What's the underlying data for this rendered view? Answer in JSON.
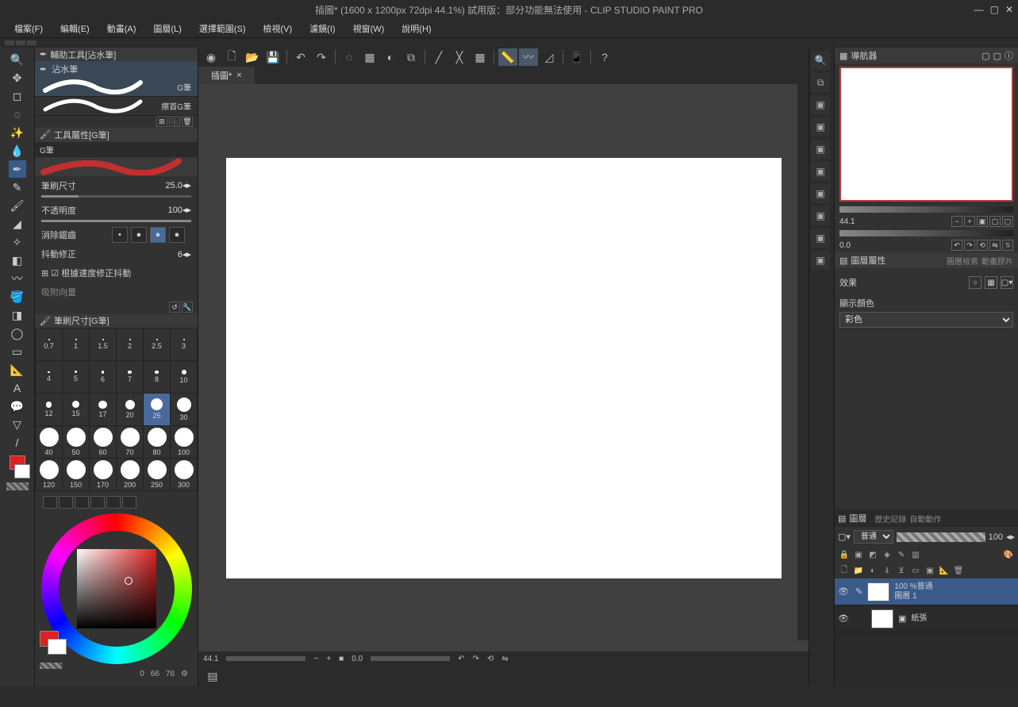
{
  "title": "插圖* (1600 x 1200px 72dpi 44.1%)  試用版：部分功能無法使用 - CLIP STUDIO PAINT PRO",
  "menu": [
    "檔案(F)",
    "編輯(E)",
    "動畫(A)",
    "圖層(L)",
    "選擇範圍(S)",
    "檢視(V)",
    "濾鏡(I)",
    "視窗(W)",
    "說明(H)"
  ],
  "doc_tab": "插圖*",
  "sub_tool_panel_title": "輔助工具[沾水筆]",
  "sub_tool_selected": "沾水筆",
  "sub_brush1": "G筆",
  "sub_brush2": "擦首G筆",
  "tool_prop_title": "工具屬性[G筆]",
  "tool_prop_brush_label": "G筆",
  "props": {
    "size_label": "筆刷尺寸",
    "size_val": "25.0",
    "opacity_label": "不透明度",
    "opacity_val": "100",
    "aa_label": "消除鋸齒",
    "stab_label": "抖動修正",
    "stab_val": "6",
    "speed_label": "根據速度修正抖動",
    "snap_label": "吸附向量"
  },
  "brush_size_panel_title": "筆刷尺寸[G筆]",
  "brush_sizes": [
    "0.7",
    "1",
    "1.5",
    "2",
    "2.5",
    "3",
    "4",
    "5",
    "6",
    "7",
    "8",
    "10",
    "12",
    "15",
    "17",
    "20",
    "25",
    "30",
    "40",
    "50",
    "60",
    "70",
    "80",
    "100",
    "120",
    "150",
    "170",
    "200",
    "250",
    "300"
  ],
  "brush_sel_idx": 16,
  "color_footer": {
    "h": "0",
    "s": "66",
    "v": "76"
  },
  "nav_title": "導航器",
  "nav_zoom": "44.1",
  "nav_rot": "0.0",
  "layerattr_title": "圖層屬性",
  "layerattr": {
    "effect": "效果",
    "display_color": "顯示顏色",
    "mode": "彩色"
  },
  "layers_title": "圖層",
  "layers_tab2": "歷史記錄",
  "layers_tab3": "自動動作",
  "blend_mode": "普通",
  "layer_opacity": "100",
  "layers": [
    {
      "name": "圖層 1",
      "info": "100 %普通",
      "sel": true,
      "paper": false
    },
    {
      "name": "紙張",
      "info": "",
      "sel": false,
      "paper": true
    }
  ],
  "canvas_foot_zoom": "44.1",
  "canvas_foot_rot": "0.0"
}
